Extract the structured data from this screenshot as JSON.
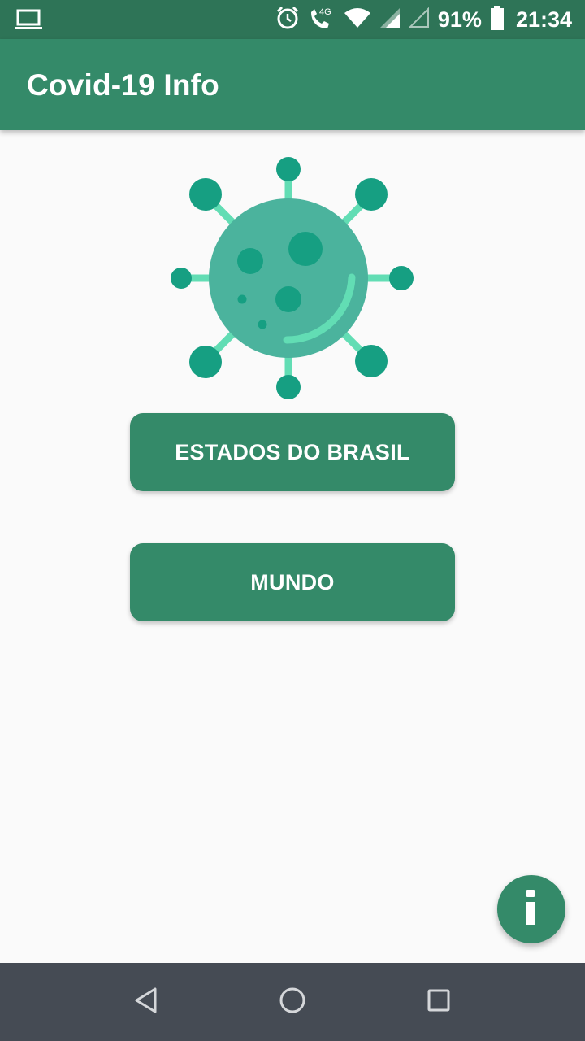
{
  "status_bar": {
    "left_icon": "laptop-icon",
    "icons": [
      "alarm-icon",
      "call-4g-icon",
      "wifi-icon",
      "cell-signal-icon",
      "cell-signal-empty-icon"
    ],
    "network_label": "4G",
    "battery_percent": "91%",
    "battery_level": 0.91,
    "time": "21:34"
  },
  "app_bar": {
    "title": "Covid-19 Info"
  },
  "main": {
    "illustration": "virus-icon",
    "buttons": [
      {
        "label": "ESTADOS DO BRASIL"
      },
      {
        "label": "MUNDO"
      }
    ]
  },
  "fab": {
    "icon": "info-icon"
  },
  "nav_bar": {
    "items": [
      "back-icon",
      "home-icon",
      "recents-icon"
    ]
  },
  "colors": {
    "status_bar": "#2e7457",
    "primary": "#348a69",
    "background": "#fafafa",
    "virus_body": "#4bb39d",
    "virus_dark": "#169f82",
    "virus_light": "#62ddb4",
    "nav_bar": "#454b54"
  }
}
